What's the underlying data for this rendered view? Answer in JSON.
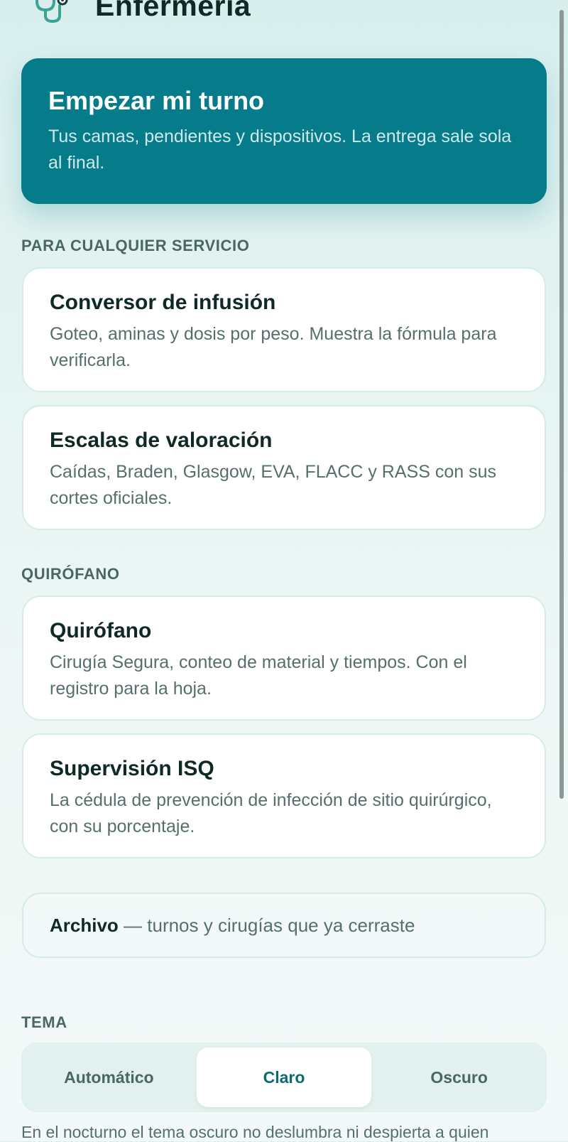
{
  "app": {
    "title": "Enfermería"
  },
  "hero": {
    "title": "Empezar mi turno",
    "description": "Tus camas, pendientes y dispositivos. La entrega sale sola al final."
  },
  "sections": {
    "general_label": "PARA CUALQUIER SERVICIO",
    "or_label": "QUIRÓFANO",
    "theme_label": "TEMA"
  },
  "cards": {
    "infusion": {
      "title": "Conversor de infusión",
      "description": "Goteo, aminas y dosis por peso. Muestra la fórmula para verificarla."
    },
    "scales": {
      "title": "Escalas de valoración",
      "description": "Caídas, Braden, Glasgow, EVA, FLACC y RASS con sus cortes oficiales."
    },
    "or": {
      "title": "Quirófano",
      "description": "Cirugía Segura, conteo de material y tiempos. Con el registro para la hoja."
    },
    "isq": {
      "title": "Supervisión ISQ",
      "description": "La cédula de prevención de infección de sitio quirúrgico, con su porcentaje."
    }
  },
  "archive": {
    "label": "Archivo",
    "description": " — turnos y cirugías que ya cerraste"
  },
  "theme": {
    "options": [
      "Automático",
      "Claro",
      "Oscuro"
    ],
    "selected": "Claro"
  },
  "footer": {
    "note": "En el nocturno el tema oscuro no deslumbra ni despierta a quien"
  },
  "colors": {
    "accent": "#067b8a",
    "background": "#e4f3f1",
    "card": "#ffffff",
    "text_primary": "#0f2a26",
    "text_secondary": "#55706c"
  },
  "icons": {
    "logo": "stethoscope-icon"
  }
}
